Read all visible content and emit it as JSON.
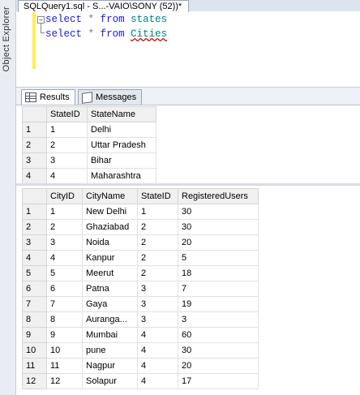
{
  "side_panel": {
    "label": "Object Explorer"
  },
  "document_tab": {
    "title": "SQLQuery1.sql - S...-VAIO\\SONY (52))*"
  },
  "editor": {
    "line1": {
      "kw1": "select",
      "star": "*",
      "kw2": "from",
      "table": "states"
    },
    "line2": {
      "kw1": "select",
      "star": "*",
      "kw2": "from",
      "table": "Cities"
    },
    "collapse_glyph": "−"
  },
  "results_tabs": {
    "results": "Results",
    "messages": "Messages"
  },
  "states_grid": {
    "columns": [
      "StateID",
      "StateName"
    ],
    "rows": [
      {
        "n": "1",
        "cells": [
          "1",
          "Delhi"
        ]
      },
      {
        "n": "2",
        "cells": [
          "2",
          "Uttar Pradesh"
        ]
      },
      {
        "n": "3",
        "cells": [
          "3",
          "Bihar"
        ]
      },
      {
        "n": "4",
        "cells": [
          "4",
          "Maharashtra"
        ]
      }
    ]
  },
  "cities_grid": {
    "columns": [
      "CityID",
      "CityName",
      "StateID",
      "RegisteredUsers"
    ],
    "rows": [
      {
        "n": "1",
        "cells": [
          "1",
          "New Delhi",
          "1",
          "30"
        ]
      },
      {
        "n": "2",
        "cells": [
          "2",
          "Ghaziabad",
          "2",
          "30"
        ]
      },
      {
        "n": "3",
        "cells": [
          "3",
          "Noida",
          "2",
          "20"
        ]
      },
      {
        "n": "4",
        "cells": [
          "4",
          "Kanpur",
          "2",
          "5"
        ]
      },
      {
        "n": "5",
        "cells": [
          "5",
          "Meerut",
          "2",
          "18"
        ]
      },
      {
        "n": "6",
        "cells": [
          "6",
          "Patna",
          "3",
          "7"
        ]
      },
      {
        "n": "7",
        "cells": [
          "7",
          "Gaya",
          "3",
          "19"
        ]
      },
      {
        "n": "8",
        "cells": [
          "8",
          "Auranga...",
          "3",
          "3"
        ]
      },
      {
        "n": "9",
        "cells": [
          "9",
          "Mumbai",
          "4",
          "60"
        ]
      },
      {
        "n": "10",
        "cells": [
          "10",
          "pune",
          "4",
          "30"
        ]
      },
      {
        "n": "11",
        "cells": [
          "11",
          "Nagpur",
          "4",
          "20"
        ]
      },
      {
        "n": "12",
        "cells": [
          "12",
          "Solapur",
          "4",
          "17"
        ]
      }
    ]
  }
}
